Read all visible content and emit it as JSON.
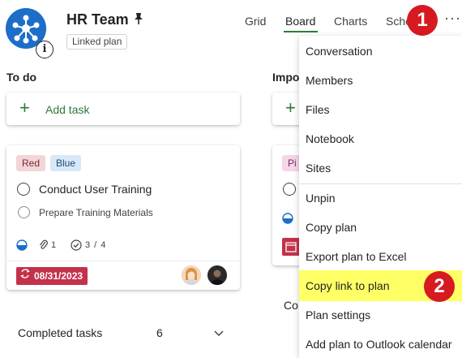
{
  "header": {
    "plan_title": "HR Team",
    "linked_tag": "Linked plan",
    "info_glyph": "i",
    "tabs": [
      {
        "label": "Grid"
      },
      {
        "label": "Board"
      },
      {
        "label": "Charts"
      },
      {
        "label": "Sche"
      }
    ],
    "more_glyph": "···"
  },
  "callouts": {
    "first": "1",
    "second": "2"
  },
  "column_todo": {
    "title": "To do",
    "add_task": "Add task",
    "card": {
      "labels": [
        {
          "text": "Red",
          "bg": "#f1d5d8",
          "fg": "#7a2a33"
        },
        {
          "text": "Blue",
          "bg": "#d7e8f8",
          "fg": "#1e4b7a"
        }
      ],
      "title": "Conduct User Training",
      "checklist_item": "Prepare Training Materials",
      "attachments": "1",
      "checklist_progress": "3 / 4",
      "due_date": "08/31/2023"
    },
    "completed_label": "Completed tasks",
    "completed_count": "6"
  },
  "column_second": {
    "title_partial": "Impo",
    "add_partial": "+",
    "label_partial": "Pi",
    "completed_partial": "Co"
  },
  "menu": {
    "items": [
      {
        "label": "Conversation"
      },
      {
        "label": "Members"
      },
      {
        "label": "Files"
      },
      {
        "label": "Notebook"
      },
      {
        "label": "Sites"
      },
      {
        "label": "Unpin"
      },
      {
        "label": "Copy plan"
      },
      {
        "label": "Export plan to Excel"
      },
      {
        "label": "Copy link to plan"
      },
      {
        "label": "Plan settings"
      },
      {
        "label": "Add plan to Outlook calendar"
      }
    ],
    "highlight_color": "#ffff66"
  },
  "colors": {
    "accent_green": "#2b7a3b",
    "callout_red": "#d71920",
    "due_red": "#c4314b",
    "logo_blue": "#1c6ec8"
  },
  "icons": [
    "pin-icon",
    "info-icon",
    "more-icon",
    "plus-icon",
    "progress-icon",
    "attachment-icon",
    "checklist-icon",
    "calendar-repeat-icon",
    "chevron-down-icon"
  ]
}
